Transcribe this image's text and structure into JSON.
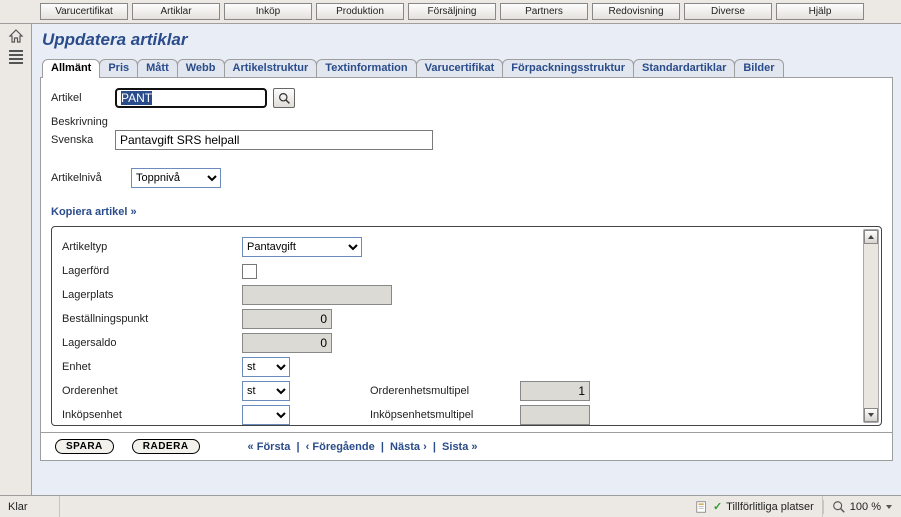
{
  "topmenu": [
    "Varucertifikat",
    "Artiklar",
    "Inköp",
    "Produktion",
    "Försäljning",
    "Partners",
    "Redovisning",
    "Diverse",
    "Hjälp"
  ],
  "page_title": "Uppdatera artiklar",
  "tabs": [
    "Allmänt",
    "Pris",
    "Mått",
    "Webb",
    "Artikelstruktur",
    "Textinformation",
    "Varucertifikat",
    "Förpackningsstruktur",
    "Standardartiklar",
    "Bilder"
  ],
  "active_tab_index": 0,
  "form": {
    "artikel_label": "Artikel",
    "artikel_value": "PANT",
    "beskrivning_label": "Beskrivning",
    "svenska_label": "Svenska",
    "svenska_value": "Pantavgift SRS helpall",
    "artikelniva_label": "Artikelnivå",
    "artikelniva_value": "Toppnivå",
    "kopiera_label": "Kopiera artikel »"
  },
  "grid": {
    "rows": [
      {
        "key": "artikeltyp",
        "label": "Artikeltyp",
        "kind": "select",
        "value": "Pantavgift",
        "width": 120
      },
      {
        "key": "lagerford",
        "label": "Lagerförd",
        "kind": "checkbox",
        "value": false
      },
      {
        "key": "lagerplats",
        "label": "Lagerplats",
        "kind": "readonly_text",
        "value": "",
        "width": 150
      },
      {
        "key": "bestallningspunkt",
        "label": "Beställningspunkt",
        "kind": "readonly_num",
        "value": "0"
      },
      {
        "key": "lagersaldo",
        "label": "Lagersaldo",
        "kind": "readonly_num",
        "value": "0"
      },
      {
        "key": "enhet",
        "label": "Enhet",
        "kind": "select",
        "value": "st",
        "width": 48
      },
      {
        "key": "orderenhet",
        "label": "Orderenhet",
        "kind": "select",
        "value": "st",
        "width": 48,
        "col2_label": "Orderenhetsmultipel",
        "col2_kind": "readonly_num",
        "col2_value": "1"
      },
      {
        "key": "inkop",
        "label": "Inköpsenhet",
        "kind": "select",
        "value": "",
        "width": 48,
        "col2_label": "Inköpsenhetsmultipel",
        "col2_kind": "readonly_num",
        "col2_value": ""
      }
    ]
  },
  "actions": {
    "save": "SPARA",
    "delete": "RADERA",
    "first": "« Första",
    "prev": "‹ Föregående",
    "next": "Nästa ›",
    "last": "Sista »"
  },
  "statusbar": {
    "ready": "Klar",
    "trusted": "Tillförlitliga platser",
    "zoom": "100 %"
  }
}
